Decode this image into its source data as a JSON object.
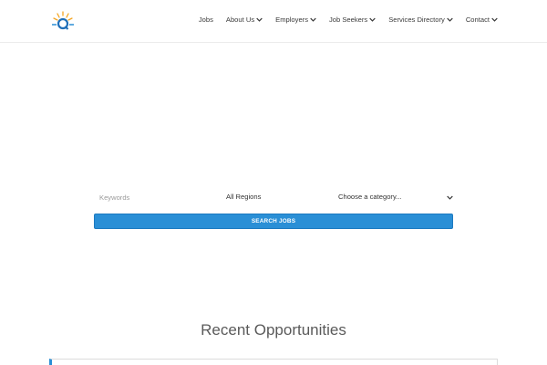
{
  "header": {
    "nav": [
      {
        "label": "Jobs",
        "has_dropdown": false
      },
      {
        "label": "About Us",
        "has_dropdown": true
      },
      {
        "label": "Employers",
        "has_dropdown": true
      },
      {
        "label": "Job Seekers",
        "has_dropdown": true
      },
      {
        "label": "Services Directory",
        "has_dropdown": true
      },
      {
        "label": "Contact",
        "has_dropdown": true
      }
    ]
  },
  "search": {
    "keywords_placeholder": "Keywords",
    "region_value": "All Regions",
    "category_value": "Choose a category...",
    "button_label": "SEARCH JOBS"
  },
  "recent": {
    "title": "Recent Opportunities"
  },
  "colors": {
    "accent": "#2a8fd6",
    "text": "#3a3a3a"
  },
  "icons": {
    "logo": "sun-q-logo",
    "dropdown": "chevron-down-icon"
  }
}
